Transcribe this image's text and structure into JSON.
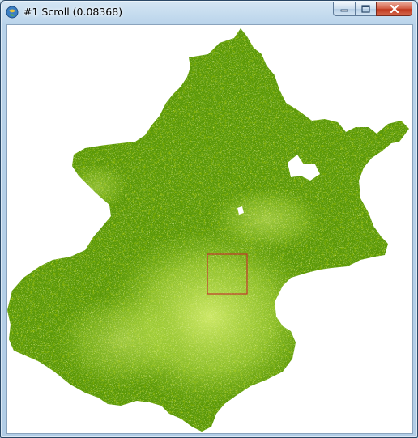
{
  "window": {
    "title": "#1 Scroll (0.08368)",
    "icons": {
      "app": "envi-globe-icon",
      "minimize": "minimize-icon",
      "maximize": "maximize-icon",
      "close": "close-icon"
    }
  },
  "image_view": {
    "content": "vegetation index raster map",
    "colors": {
      "dark_vegetation": "#4e8a00",
      "mid_vegetation": "#6aa30f",
      "light_vegetation": "#c8e85a",
      "background": "#ffffff",
      "zoom_box": "#c0392b"
    }
  }
}
